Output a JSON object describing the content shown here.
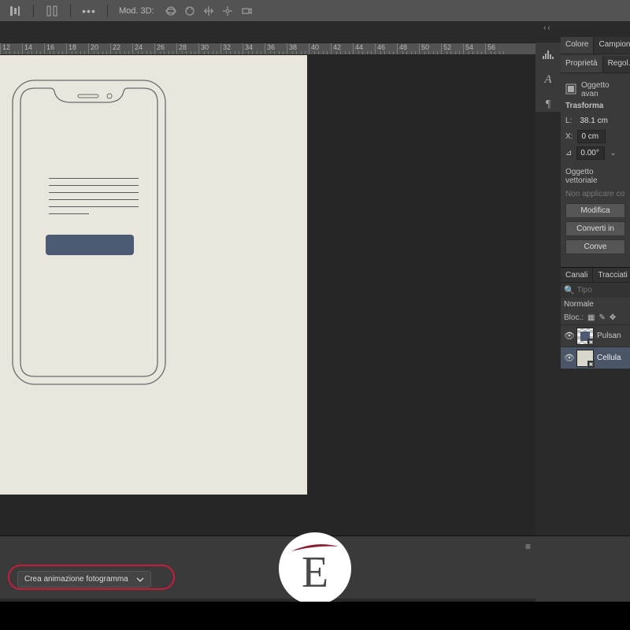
{
  "optbar": {
    "mode3d_label": "Mod. 3D:"
  },
  "collapse_arrows": "‹‹",
  "ruler": [
    12,
    14,
    16,
    18,
    20,
    22,
    24,
    26,
    28,
    30,
    32,
    34,
    36,
    38,
    40,
    42,
    44,
    46,
    48,
    50,
    52,
    54,
    56
  ],
  "panels": {
    "color_tab": "Colore",
    "campioni_tab": "Campion",
    "proprieta_tab": "Proprietà",
    "regolazioni_tab": "Regol.",
    "smart_object_label": "Oggetto avan",
    "trasforma_title": "Trasforma",
    "L_label": "L:",
    "L_value": "38.1 cm",
    "X_label": "X:",
    "X_value": "0 cm",
    "angle_value": "0.00°",
    "angle_symbol": "⊿",
    "vettoriale_title": "Oggetto vettoriale",
    "non_applicare": "Non applicare co",
    "btn_modifica": "Modifica",
    "btn_converti_in": "Converti in",
    "btn_converti": "Conve",
    "canali_tab": "Canali",
    "tracciati_tab": "Tracciati",
    "search_placeholder": "Tipo",
    "blend_mode": "Normale",
    "lock_label": "Bloc.:",
    "layer1": "Pulsan",
    "layer2": "Cellula"
  },
  "timeline": {
    "create_button": "Crea animazione fotogramma"
  },
  "watermark_letter": "E"
}
